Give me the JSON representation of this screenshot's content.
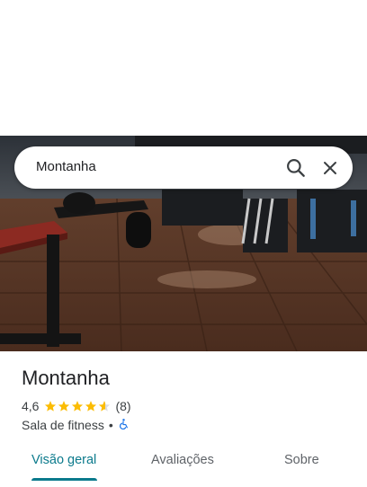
{
  "search": {
    "query": "Montanha",
    "search_icon": "search-icon",
    "close_icon": "close-icon"
  },
  "hero": {
    "image": "gym-interior-photo"
  },
  "place": {
    "name": "Montanha",
    "rating": "4,6",
    "rating_value": 4.6,
    "rating_max": 5,
    "review_count": "(8)",
    "category": "Sala de fitness",
    "separator": "•",
    "accessibility_icon": "wheelchair-accessible-icon"
  },
  "tabs": [
    {
      "label": "Visão geral",
      "active": true
    },
    {
      "label": "Avaliações",
      "active": false
    },
    {
      "label": "Sobre",
      "active": false
    }
  ],
  "colors": {
    "accent": "#0b7a8c",
    "star": "#fbbc04",
    "accessibility": "#1a73e8"
  }
}
